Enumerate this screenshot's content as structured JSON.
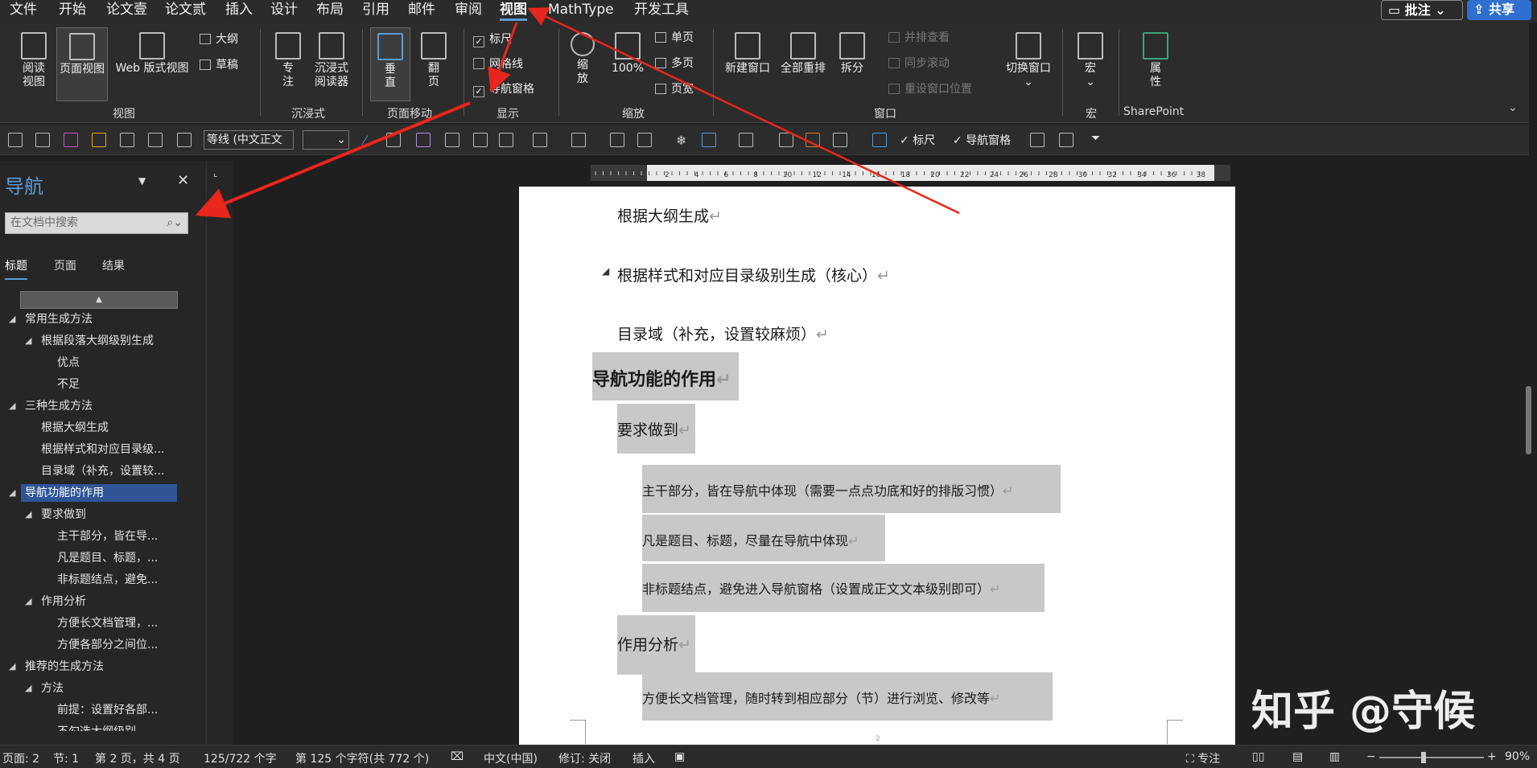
{
  "menubar": {
    "items": [
      "文件",
      "开始",
      "论文壹",
      "论文贰",
      "插入",
      "设计",
      "布局",
      "引用",
      "邮件",
      "审阅",
      "视图",
      "MathType",
      "开发工具"
    ],
    "active": "视图",
    "comments": "批注",
    "share": "共享"
  },
  "ribbon": {
    "buttons": {
      "read": "阅读\n视图",
      "page": "页面视图",
      "web": "Web 版式视图",
      "outline": "大纲",
      "draft": "草稿",
      "focus": "专\n注",
      "immersive": "沉浸式\n阅读器",
      "vertical": "垂\n直",
      "flip": "翻\n页",
      "ruler": "标尺",
      "grid": "网格线",
      "navpane": "导航窗格",
      "zoom": "缩\n放",
      "zoom100": "100%",
      "onepage": "单页",
      "multipage": "多页",
      "pagewidth": "页宽",
      "newwin": "新建窗口",
      "arrange": "全部重排",
      "split": "拆分",
      "sidebyside": "并排查看",
      "syncscroll": "同步滚动",
      "resetpos": "重设窗口位置",
      "switchwin": "切换窗口",
      "macro": "宏",
      "props": "属\n性"
    },
    "groups": {
      "view": "视图",
      "immersive": "沉浸式",
      "pagemove": "页面移动",
      "show": "显示",
      "zoom": "缩放",
      "window": "窗口",
      "macro": "宏",
      "sharepoint": "SharePoint"
    }
  },
  "qat": {
    "font": "等线 (中文正文",
    "size": "",
    "ruler": "标尺",
    "navpane": "导航窗格"
  },
  "nav": {
    "title": "导航",
    "search_placeholder": "在文档中搜索",
    "tabs": [
      "标题",
      "页面",
      "结果"
    ],
    "tree": [
      "常用生成方法",
      "根据段落大纲级别生成",
      "优点",
      "不足",
      "三种生成方法",
      "根据大纲生成",
      "根据样式和对应目录级...",
      "目录域（补充，设置较...",
      "导航功能的作用",
      "要求做到",
      "主干部分，皆在导...",
      "凡是题目、标题，...",
      "非标题结点，避免...",
      "作用分析",
      "方便长文档管理，...",
      "方便各部分之间位...",
      "推荐的生成方法",
      "方法",
      "前提：设置好各部...",
      "不勾选大纲级别..."
    ]
  },
  "document": {
    "p1": "根据大纲生成",
    "p2": "根据样式和对应目录级别生成（核心）",
    "p3": "目录域（补充，设置较麻烦）",
    "h1": "导航功能的作用",
    "p4": "要求做到",
    "p5": "主干部分，皆在导航中体现（需要一点点功底和好的排版习惯）",
    "p6": "凡是题目、标题，尽量在导航中体现",
    "p7": "非标题结点，避免进入导航窗格（设置成正文文本级别即可）",
    "p8": "作用分析",
    "p9": "方便长文档管理，随时转到相应部分（节）进行浏览、修改等",
    "mark": "↵",
    "footer_num": "2"
  },
  "watermark": "知乎 @守候",
  "status": {
    "page": "页面: 2",
    "section": "节: 1",
    "pageof": "第 2 页，共 4 页",
    "words": "125/722 个字",
    "chars": "第 125 个字符(共 772 个)",
    "lang": "中文(中国)",
    "track": "修订: 关闭",
    "insert": "插入",
    "focus": "专注",
    "zoom": "90%"
  },
  "ruler": {
    "ticks": [
      "2",
      "4",
      "6",
      "8",
      "10",
      "12",
      "14",
      "16",
      "18",
      "20",
      "22",
      "24",
      "26",
      "28",
      "30",
      "32",
      "34",
      "36",
      "38"
    ]
  }
}
